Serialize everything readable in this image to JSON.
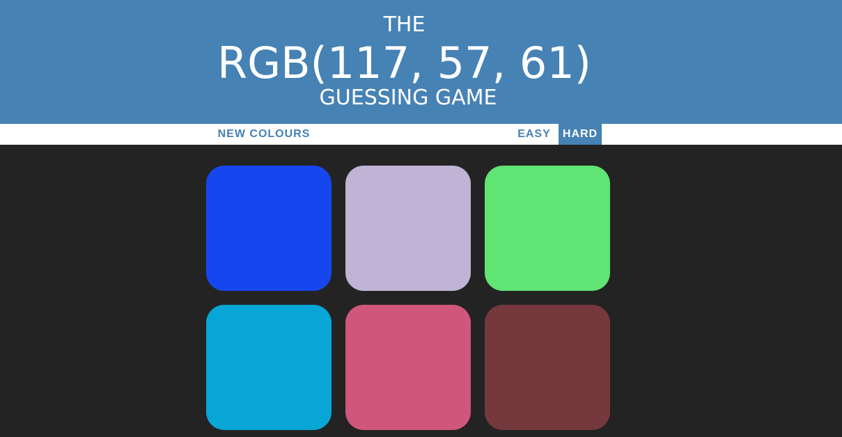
{
  "header": {
    "line1": "THE",
    "rgb_display": "RGB(117, 57, 61)",
    "line3": "GUESSING GAME",
    "background": "#4682b4"
  },
  "controls": {
    "new_colours_label": "NEW COLOURS",
    "easy_label": "EASY",
    "hard_label": "HARD",
    "selected_mode": "HARD"
  },
  "squares": [
    {
      "color": "#1647ee"
    },
    {
      "color": "#bfb4d5"
    },
    {
      "color": "#60e474"
    },
    {
      "color": "#07a6d6"
    },
    {
      "color": "#d0567c"
    },
    {
      "color": "#75393d"
    }
  ]
}
